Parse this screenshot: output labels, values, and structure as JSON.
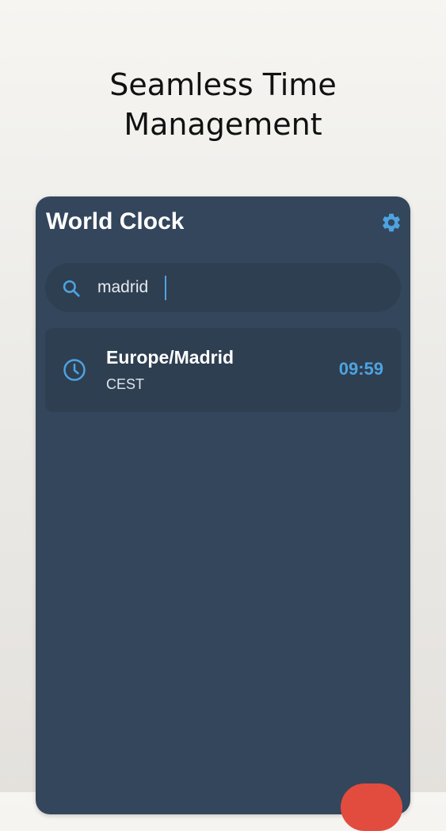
{
  "promo": {
    "headline_line1": "Seamless Time",
    "headline_line2": "Management"
  },
  "app": {
    "title": "World Clock",
    "settings_icon": "gear-icon"
  },
  "search": {
    "value": "madrid",
    "icon": "search-icon"
  },
  "results": [
    {
      "timezone": "Europe/Madrid",
      "abbreviation": "CEST",
      "time": "09:59",
      "icon": "clock-icon"
    }
  ],
  "colors": {
    "background": "#ecebe8",
    "app_background": "#34465b",
    "card_background": "#2f3f52",
    "accent": "#4da3e0",
    "fab": "#e24c3f"
  }
}
